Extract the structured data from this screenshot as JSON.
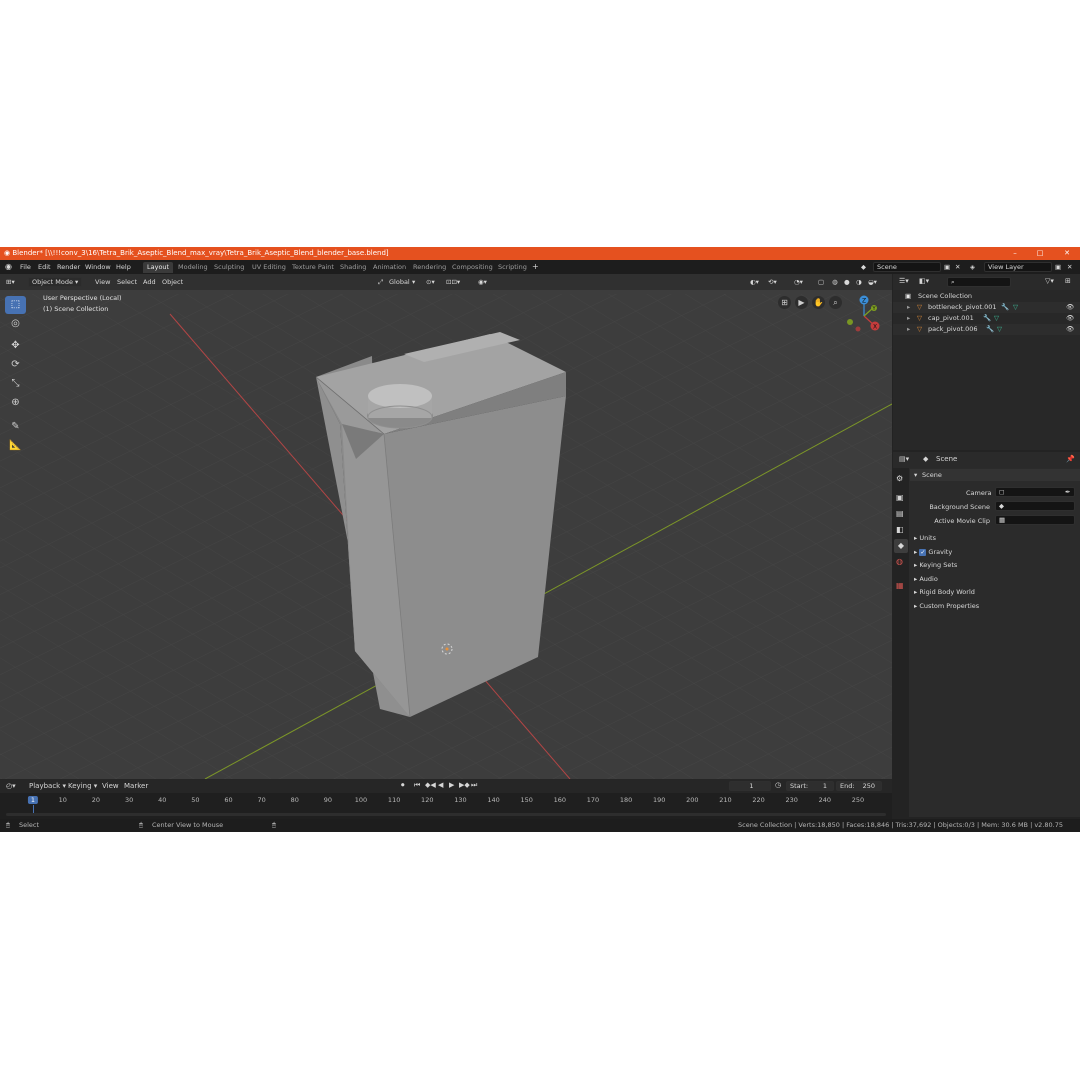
{
  "window": {
    "title": "Blender* [\\\\!!!conv_3\\16\\Tetra_Brik_Aseptic_Blend_max_vray\\Tetra_Brik_Aseptic_Blend_blender_base.blend]",
    "controls": [
      "–",
      "□",
      "✕"
    ]
  },
  "menu": [
    "File",
    "Edit",
    "Render",
    "Window",
    "Help"
  ],
  "workspaces": [
    "Layout",
    "Modeling",
    "Sculpting",
    "UV Editing",
    "Texture Paint",
    "Shading",
    "Animation",
    "Rendering",
    "Compositing",
    "Scripting"
  ],
  "active_workspace": "Layout",
  "add_tab": "+",
  "scene_field": "Scene",
  "view_layer_field": "View Layer",
  "viewport": {
    "mode": "Object Mode",
    "menus": [
      "View",
      "Select",
      "Add",
      "Object"
    ],
    "transform_orientation": "Global",
    "view_info": "User Perspective (Local)",
    "collection_info": "(1) Scene Collection",
    "gizmo_axes": {
      "x": "X",
      "y": "Y",
      "z": "Z"
    }
  },
  "outliner": {
    "root": "Scene Collection",
    "items": [
      "bottleneck_pivot.001",
      "cap_pivot.001",
      "pack_pivot.006"
    ]
  },
  "properties": {
    "header": "Scene",
    "panel": "Scene",
    "fields": [
      {
        "label": "Camera"
      },
      {
        "label": "Background Scene"
      },
      {
        "label": "Active Movie Clip"
      }
    ],
    "subpanels": [
      "Units",
      "Gravity",
      "Keying Sets",
      "Audio",
      "Rigid Body World",
      "Custom Properties"
    ],
    "gravity_checked": true
  },
  "timeline": {
    "menus": [
      "Playback",
      "Keying",
      "View",
      "Marker"
    ],
    "current_frame": "1",
    "start_label": "Start:",
    "start": "1",
    "end_label": "End:",
    "end": "250",
    "ticks": [
      "1",
      "10",
      "20",
      "30",
      "40",
      "50",
      "60",
      "70",
      "80",
      "90",
      "100",
      "110",
      "120",
      "130",
      "140",
      "150",
      "160",
      "170",
      "180",
      "190",
      "200",
      "210",
      "220",
      "230",
      "240",
      "250"
    ]
  },
  "status": {
    "left": "Select",
    "middle": "Center View to Mouse",
    "right": "Scene Collection | Verts:18,850 | Faces:18,846 | Tris:37,692 | Objects:0/3 | Mem: 30.6 MB | v2.80.75"
  },
  "colors": {
    "title_bar": "#e5511f",
    "viewport_bg": "#3d3d3d",
    "active_blue": "#4772b3",
    "axis_x_red": "#c43c3c",
    "axis_y_green": "#7fa020",
    "axis_z_blue": "#3b8fd9",
    "object_orange": "#e8913a"
  }
}
